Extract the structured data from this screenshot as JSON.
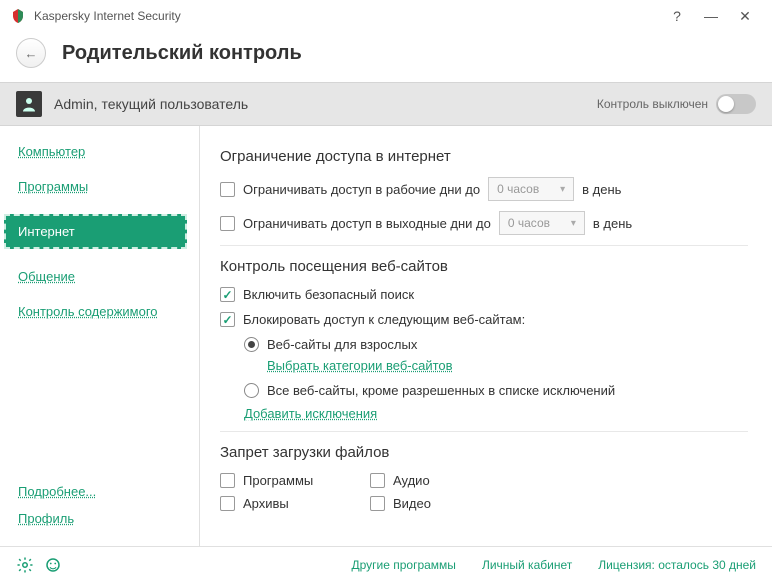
{
  "app": {
    "title": "Kaspersky Internet Security"
  },
  "page": {
    "title": "Родительский контроль"
  },
  "user": {
    "name": "Admin, текущий пользователь",
    "control_label": "Контроль выключен"
  },
  "sidebar": {
    "items": [
      {
        "label": "Компьютер"
      },
      {
        "label": "Программы"
      },
      {
        "label": "Интернет"
      },
      {
        "label": "Общение"
      },
      {
        "label": "Контроль содержимого"
      }
    ],
    "bottom": [
      {
        "label": "Подробнее..."
      },
      {
        "label": "Профиль"
      }
    ]
  },
  "sections": {
    "access": {
      "title": "Ограничение доступа в интернет",
      "weekday_label": "Ограничивать доступ в рабочие дни до",
      "weekend_label": "Ограничивать доступ в выходные дни до",
      "hours_value": "0 часов",
      "per_day": "в день"
    },
    "websites": {
      "title": "Контроль посещения веб-сайтов",
      "safe_search": "Включить безопасный поиск",
      "block_label": "Блокировать доступ к следующим веб-сайтам:",
      "adult_label": "Веб-сайты для взрослых",
      "categories_link": "Выбрать категории веб-сайтов",
      "all_except_label": "Все веб-сайты, кроме разрешенных в списке исключений",
      "exclusions_link": "Добавить исключения"
    },
    "downloads": {
      "title": "Запрет загрузки файлов",
      "programs": "Программы",
      "audio": "Аудио",
      "archives": "Архивы",
      "video": "Видео"
    }
  },
  "footer": {
    "other": "Другие программы",
    "account": "Личный кабинет",
    "license": "Лицензия: осталось 30 дней"
  }
}
